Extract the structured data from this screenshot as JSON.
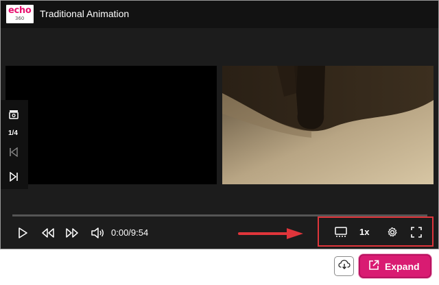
{
  "header": {
    "logo_text": "echo",
    "logo_sub": "360",
    "title": "Traditional Animation"
  },
  "side_rail": {
    "slide_counter": "1/4",
    "icons": [
      "slides-icon",
      "previous-slide-icon",
      "next-slide-icon"
    ]
  },
  "player": {
    "time": "0:00/9:54",
    "speed": "1x",
    "progress_fraction": 0,
    "icons": [
      "play-icon",
      "rewind-icon",
      "fast-forward-icon",
      "volume-icon",
      "captions-icon",
      "settings-icon",
      "fullscreen-icon"
    ]
  },
  "footer": {
    "expand_label": "Expand",
    "icons": [
      "cloud-download-icon",
      "external-link-icon"
    ]
  },
  "colors": {
    "brand": "#d91b72",
    "highlight": "#e0353b",
    "player_bg": "#1c1c1c"
  }
}
